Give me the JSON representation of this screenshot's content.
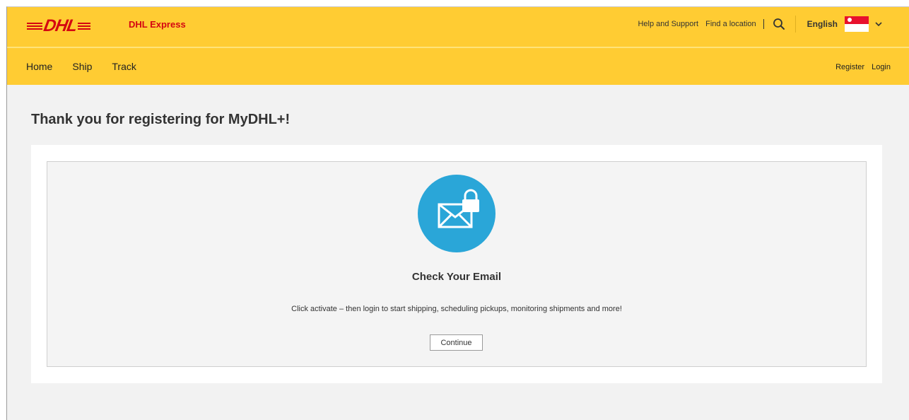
{
  "brand": {
    "logo_text": "DHL",
    "name": "DHL Express",
    "colors": {
      "primary_yellow": "#ffcc33",
      "brand_red": "#d40511",
      "accent_blue": "#2aa6d8"
    }
  },
  "utility_nav": {
    "help": "Help and Support",
    "locations": "Find a location",
    "search_icon": "search-icon",
    "language": "English",
    "flag_icon": "singapore-flag-icon",
    "dropdown_icon": "chevron-down-icon"
  },
  "main_nav": {
    "home": "Home",
    "ship": "Ship",
    "track": "Track"
  },
  "account_nav": {
    "register": "Register",
    "login": "Login"
  },
  "page": {
    "title": "Thank you for registering for MyDHL+!"
  },
  "confirmation": {
    "icon": "email-lock-icon",
    "heading": "Check Your Email",
    "message": "Click activate – then login to start shipping, scheduling pickups, monitoring shipments and more!",
    "continue_label": "Continue"
  }
}
